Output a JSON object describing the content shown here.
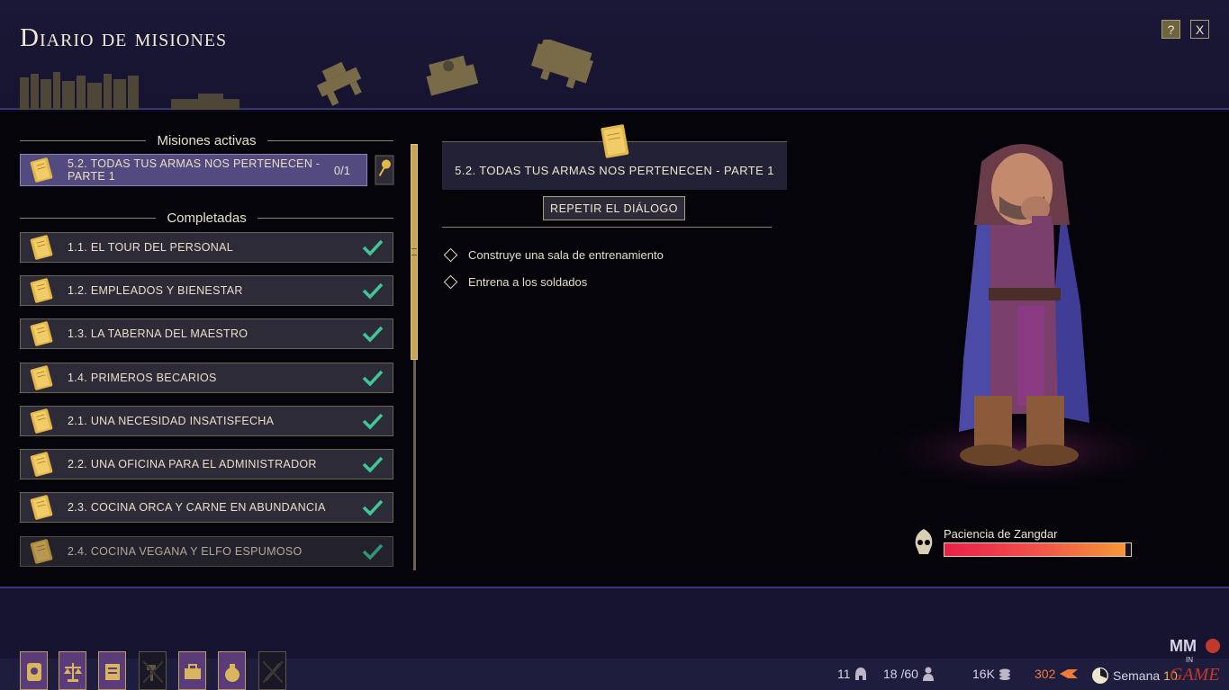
{
  "header": {
    "title": "Diario de misiones",
    "help_label": "?",
    "close_label": "X",
    "category_icons": [
      "books-icon",
      "scrolls-icon",
      "anvil-icon",
      "crates-icon"
    ]
  },
  "quest_list": {
    "active_header": "Misiones activas",
    "completed_header": "Completadas",
    "active": [
      {
        "name": "5.2. TODAS TUS ARMAS NOS PERTENECEN - PARTE 1",
        "progress": "0/1"
      }
    ],
    "completed": [
      {
        "name": "1.1. EL TOUR DEL PERSONAL"
      },
      {
        "name": "1.2. EMPLEADOS Y BIENESTAR"
      },
      {
        "name": "1.3. LA TABERNA DEL MAESTRO"
      },
      {
        "name": "1.4. PRIMEROS BECARIOS"
      },
      {
        "name": "2.1. UNA NECESIDAD INSATISFECHA"
      },
      {
        "name": "2.2. UNA OFICINA PARA EL ADMINISTRADOR"
      },
      {
        "name": "2.3. COCINA ORCA Y CARNE EN ABUNDANCIA"
      },
      {
        "name": "2.4. COCINA VEGANA Y ELFO ESPUMOSO"
      }
    ]
  },
  "detail": {
    "title": "5.2. TODAS TUS ARMAS NOS PERTENECEN - PARTE 1",
    "repeat_label": "REPETIR EL DIÁLOGO",
    "objectives": [
      "Construye una sala de entrenamiento",
      "Entrena a los soldados"
    ]
  },
  "character": {
    "patience_label": "Paciencia de Zangdar",
    "patience_fraction": 0.97
  },
  "status_bar": {
    "count_a": "11",
    "staff": "18 /60",
    "gold": "16K",
    "reputation": "302",
    "week_label": "Semana",
    "week_number": "10",
    "tools": [
      "quest-scroll-icon",
      "balance-icon",
      "notice-icon",
      "hammer-icon",
      "briefcase-icon",
      "moneybag-icon",
      "sword-icon"
    ]
  },
  "colors": {
    "accent_gold": "#c9a55a",
    "check_green": "#3fc79a",
    "active_row": "#534a80",
    "patience_red": "#e8204a",
    "patience_orange": "#f49838"
  }
}
